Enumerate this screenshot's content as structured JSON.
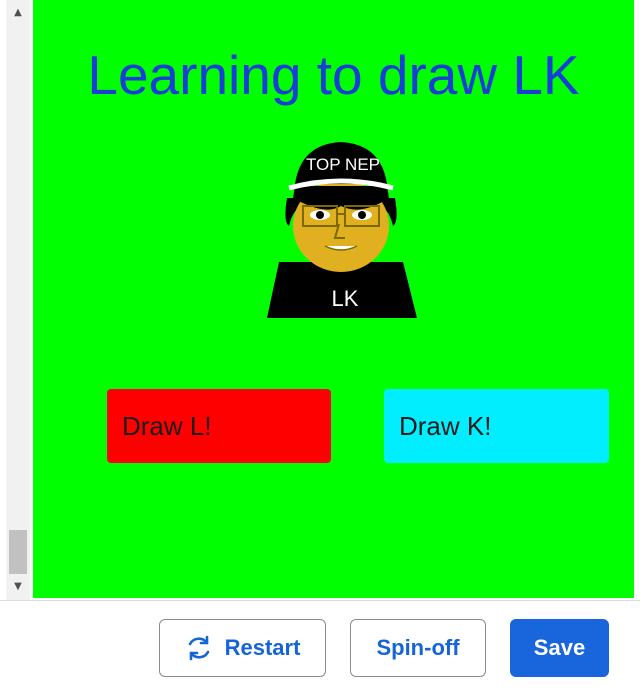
{
  "program": {
    "title": "Learning to draw LK",
    "avatar": {
      "hat_text": "TOP NEP",
      "shirt_text": "LK"
    },
    "buttons": [
      {
        "label": "Draw L!",
        "color": "#ff0000"
      },
      {
        "label": "Draw K!",
        "color": "#00eeff"
      }
    ],
    "background": "#00ff00",
    "title_color": "#1a3fd6"
  },
  "footer": {
    "restart_label": "Restart",
    "spinoff_label": "Spin-off",
    "save_label": "Save",
    "accent": "#1865dc"
  },
  "scrollbar": {
    "up_icon": "arrow-up",
    "down_icon": "arrow-down"
  }
}
